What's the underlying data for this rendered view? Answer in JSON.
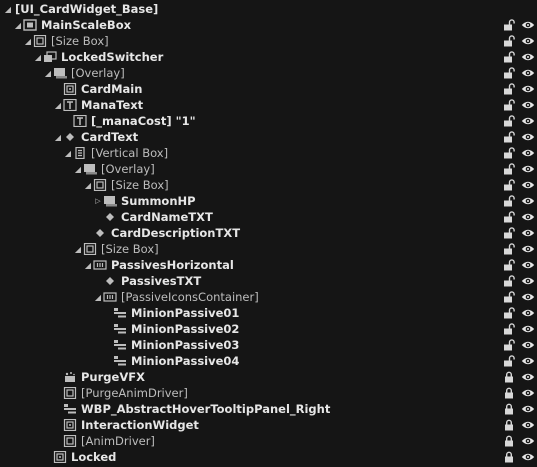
{
  "tree": [
    {
      "label": "[UI_CardWidget_Base]",
      "depth": 0,
      "icon": "none-icon",
      "expander": "expanded",
      "bold": true,
      "lock": "none",
      "eye": false
    },
    {
      "label": "MainScaleBox",
      "depth": 1,
      "icon": "scale-box-icon",
      "expander": "expanded",
      "bold": true,
      "lock": "unlocked",
      "eye": true
    },
    {
      "label": "[Size Box]",
      "depth": 2,
      "icon": "size-box-icon",
      "expander": "expanded",
      "bold": false,
      "lock": "unlocked",
      "eye": true
    },
    {
      "label": "LockedSwitcher",
      "depth": 3,
      "icon": "switcher-icon",
      "expander": "expanded",
      "bold": true,
      "lock": "unlocked",
      "eye": true
    },
    {
      "label": "[Overlay]",
      "depth": 4,
      "icon": "overlay-icon",
      "expander": "expanded",
      "bold": false,
      "lock": "unlocked",
      "eye": true
    },
    {
      "label": "CardMain",
      "depth": 5,
      "icon": "image-icon",
      "expander": "none",
      "bold": true,
      "lock": "unlocked",
      "eye": true
    },
    {
      "label": "ManaText",
      "depth": 5,
      "icon": "text-icon",
      "expander": "expanded",
      "bold": true,
      "lock": "unlocked",
      "eye": true
    },
    {
      "label": "[_manaCost] \"1\"",
      "depth": 6,
      "icon": "text-block-icon",
      "expander": "none",
      "bold": true,
      "lock": "unlocked",
      "eye": true
    },
    {
      "label": "CardText",
      "depth": 5,
      "icon": "widget-icon",
      "expander": "expanded",
      "bold": true,
      "lock": "unlocked",
      "eye": true
    },
    {
      "label": "[Vertical Box]",
      "depth": 6,
      "icon": "vertical-box-icon",
      "expander": "expanded",
      "bold": false,
      "lock": "unlocked",
      "eye": true
    },
    {
      "label": "[Overlay]",
      "depth": 7,
      "icon": "overlay-icon",
      "expander": "expanded",
      "bold": false,
      "lock": "unlocked",
      "eye": true
    },
    {
      "label": "[Size Box]",
      "depth": 8,
      "icon": "size-box-icon",
      "expander": "expanded",
      "bold": false,
      "lock": "unlocked",
      "eye": true
    },
    {
      "label": "SummonHP",
      "depth": 9,
      "icon": "overlay-icon",
      "expander": "collapsed",
      "bold": true,
      "lock": "unlocked",
      "eye": true
    },
    {
      "label": "CardNameTXT",
      "depth": 9,
      "icon": "widget-icon",
      "expander": "none",
      "bold": true,
      "lock": "unlocked",
      "eye": true
    },
    {
      "label": "CardDescriptionTXT",
      "depth": 8,
      "icon": "widget-icon",
      "expander": "none",
      "bold": true,
      "lock": "unlocked",
      "eye": true
    },
    {
      "label": "[Size Box]",
      "depth": 7,
      "icon": "size-box-icon",
      "expander": "expanded",
      "bold": false,
      "lock": "unlocked",
      "eye": true
    },
    {
      "label": "PassivesHorizontal",
      "depth": 8,
      "icon": "horizontal-box-icon",
      "expander": "expanded",
      "bold": true,
      "lock": "unlocked",
      "eye": true
    },
    {
      "label": "PassivesTXT",
      "depth": 9,
      "icon": "widget-icon",
      "expander": "none",
      "bold": true,
      "lock": "unlocked",
      "eye": true
    },
    {
      "label": "[PassiveIconsContainer]",
      "depth": 9,
      "icon": "horizontal-box-icon",
      "expander": "expanded",
      "bold": false,
      "lock": "unlocked",
      "eye": true
    },
    {
      "label": "MinionPassive01",
      "depth": 10,
      "icon": "user-widget-icon",
      "expander": "none",
      "bold": true,
      "lock": "unlocked",
      "eye": true
    },
    {
      "label": "MinionPassive02",
      "depth": 10,
      "icon": "user-widget-icon",
      "expander": "none",
      "bold": true,
      "lock": "unlocked",
      "eye": true
    },
    {
      "label": "MinionPassive03",
      "depth": 10,
      "icon": "user-widget-icon",
      "expander": "none",
      "bold": true,
      "lock": "unlocked",
      "eye": true
    },
    {
      "label": "MinionPassive04",
      "depth": 10,
      "icon": "user-widget-icon",
      "expander": "none",
      "bold": true,
      "lock": "unlocked",
      "eye": true
    },
    {
      "label": "PurgeVFX",
      "depth": 5,
      "icon": "vfx-icon",
      "expander": "none",
      "bold": true,
      "lock": "locked",
      "eye": true
    },
    {
      "label": "[PurgeAnimDriver]",
      "depth": 5,
      "icon": "size-box-icon",
      "expander": "none",
      "bold": false,
      "lock": "locked",
      "eye": true
    },
    {
      "label": "WBP_AbstractHoverTooltipPanel_Right",
      "depth": 5,
      "icon": "user-widget-icon",
      "expander": "none",
      "bold": true,
      "lock": "locked",
      "eye": true
    },
    {
      "label": "InteractionWidget",
      "depth": 5,
      "icon": "image-icon",
      "expander": "none",
      "bold": true,
      "lock": "locked",
      "eye": true
    },
    {
      "label": "[AnimDriver]",
      "depth": 5,
      "icon": "size-box-icon",
      "expander": "none",
      "bold": false,
      "lock": "locked",
      "eye": true
    },
    {
      "label": "Locked",
      "depth": 4,
      "icon": "image-icon",
      "expander": "none",
      "bold": true,
      "lock": "locked",
      "eye": true
    }
  ]
}
